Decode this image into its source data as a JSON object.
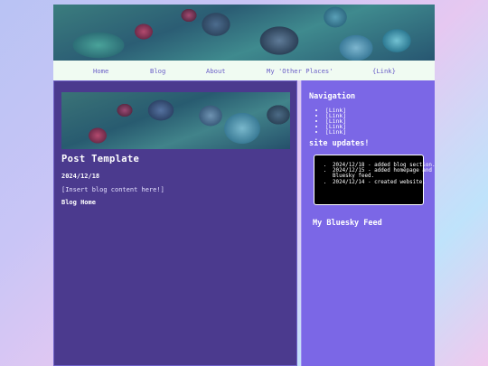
{
  "nav": {
    "links": [
      "Home",
      "Blog",
      "About",
      "My 'Other Places'",
      "{Link}"
    ]
  },
  "post": {
    "title": "Post Template",
    "date": "2024/12/18",
    "body": "[Insert blog content here!]",
    "home_link": "Blog Home"
  },
  "sidebar": {
    "navigation_heading": "Navigation",
    "links": [
      "[Link]",
      "[Link]",
      "[Link]",
      "[Link]",
      "[Link]"
    ],
    "updates_heading": "site updates!",
    "updates": [
      "2024/12/18 - added blog section.",
      "2024/12/15 - added homepage and Bluesky feed.",
      "2024/12/14 - created website."
    ],
    "bluesky_heading": "My Bluesky Feed"
  },
  "colors": {
    "main_bg": "#4b3a8e",
    "side_bg": "#7b67e6",
    "nav_bg": "#f0fbf2",
    "nav_text": "#6a5ec7"
  }
}
